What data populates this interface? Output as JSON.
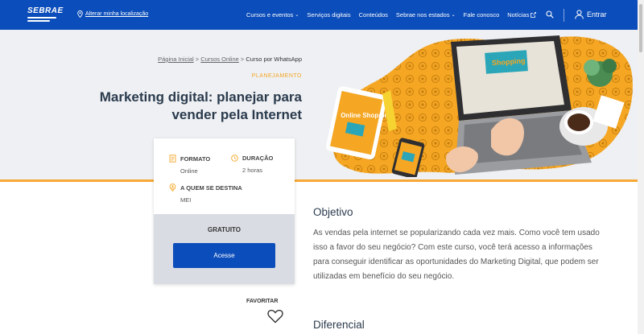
{
  "nav": {
    "logo": "SEBRAE",
    "location": "Alterar minha localização",
    "menu": [
      {
        "label": "Cursos e eventos",
        "chevron": true
      },
      {
        "label": "Serviços digitais",
        "chevron": false
      },
      {
        "label": "Conteúdos",
        "chevron": false
      },
      {
        "label": "Sebrae nos estados",
        "chevron": true
      },
      {
        "label": "Fale conosco",
        "chevron": false
      },
      {
        "label": "Notícias",
        "chevron": false,
        "external": true
      }
    ],
    "login": "Entrar",
    "brand_color": "#0b4dba"
  },
  "breadcrumb": {
    "home": "Página Inicial",
    "sep1": " > ",
    "courses": "Cursos Online",
    "sep2": " > ",
    "current": "Curso por WhatsApp"
  },
  "hero": {
    "category": "PLANEJAMENTO",
    "title": "Marketing digital: planejar para vender pela Internet",
    "accent_color": "#f7a836"
  },
  "card": {
    "format_label": "FORMATO",
    "format_value": "Online",
    "duration_label": "DURAÇÃO",
    "duration_value": "2 horas",
    "audience_label": "A QUEM SE DESTINA",
    "audience_value": "MEI",
    "price": "GRATUITO",
    "cta": "Acesse"
  },
  "favorite": "FAVORITAR",
  "content": {
    "objetivo_title": "Objetivo",
    "objetivo_text": "As vendas pela internet se popularizando cada vez mais. Como você tem usado isso a favor do seu negócio? Com este curso, você terá acesso a informações para conseguir identificar as oportunidades do Marketing Digital, que podem ser utilizadas em benefício do seu negócio.",
    "diferencial_title": "Diferencial"
  },
  "illustration": {
    "tablet_text": "Online Shopping",
    "screen_text": "Shopping"
  }
}
